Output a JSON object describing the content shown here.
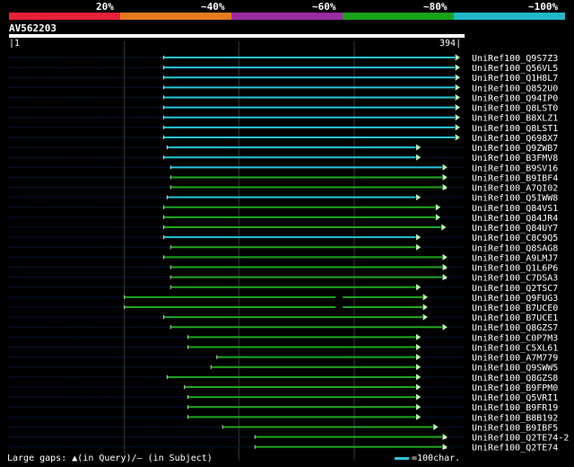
{
  "legend": {
    "segments": [
      {
        "label": "20%",
        "color": "#e8203a"
      },
      {
        "label": "~40%",
        "color": "#e67a1e"
      },
      {
        "label": "~60%",
        "color": "#9a2ba4"
      },
      {
        "label": "~80%",
        "color": "#1aa21a"
      },
      {
        "label": "~100%",
        "color": "#20b8c8"
      }
    ]
  },
  "query": {
    "name": "AV562203",
    "start": "1",
    "end": "394"
  },
  "colors": {
    "high": "#27c6d8",
    "mid": "#1fa81f",
    "arrow": "#b8f5b0",
    "gap": "#3a3a3a",
    "track": "#0a1a4a"
  },
  "hits": [
    {
      "name": "UniRef100_Q9S7Z3",
      "qstart": 135,
      "qend": 392,
      "identity": "high"
    },
    {
      "name": "UniRef100_Q56VL5",
      "qstart": 135,
      "qend": 392,
      "identity": "high"
    },
    {
      "name": "UniRef100_Q1H8L7",
      "qstart": 135,
      "qend": 392,
      "identity": "high"
    },
    {
      "name": "UniRef100_Q852U0",
      "qstart": 135,
      "qend": 392,
      "identity": "high"
    },
    {
      "name": "UniRef100_Q94IP0",
      "qstart": 135,
      "qend": 392,
      "identity": "high"
    },
    {
      "name": "UniRef100_Q8LST0",
      "qstart": 135,
      "qend": 392,
      "identity": "high"
    },
    {
      "name": "UniRef100_B8XLZ1",
      "qstart": 135,
      "qend": 392,
      "identity": "high"
    },
    {
      "name": "UniRef100_Q8LST1",
      "qstart": 135,
      "qend": 392,
      "identity": "high"
    },
    {
      "name": "UniRef100_Q698X7",
      "qstart": 135,
      "qend": 392,
      "identity": "high"
    },
    {
      "name": "UniRef100_Q9ZWB7",
      "qstart": 138,
      "qend": 358,
      "identity": "high"
    },
    {
      "name": "UniRef100_B3FMV8",
      "qstart": 135,
      "qend": 358,
      "identity": "high"
    },
    {
      "name": "UniRef100_B9SV16",
      "qstart": 141,
      "qend": 381,
      "identity": "high"
    },
    {
      "name": "UniRef100_B9IBF4",
      "qstart": 141,
      "qend": 381,
      "identity": "mid"
    },
    {
      "name": "UniRef100_A7QI02",
      "qstart": 141,
      "qend": 381,
      "identity": "mid",
      "gapmark": true
    },
    {
      "name": "UniRef100_Q5IWW8",
      "qstart": 138,
      "qend": 358,
      "identity": "high"
    },
    {
      "name": "UniRef100_Q84VS1",
      "qstart": 135,
      "qend": 375,
      "identity": "mid"
    },
    {
      "name": "UniRef100_Q84JR4",
      "qstart": 135,
      "qend": 375,
      "identity": "mid"
    },
    {
      "name": "UniRef100_Q84UY7",
      "qstart": 135,
      "qend": 380,
      "identity": "mid"
    },
    {
      "name": "UniRef100_C8C9Q5",
      "qstart": 135,
      "qend": 358,
      "identity": "high"
    },
    {
      "name": "UniRef100_Q8SAG8",
      "qstart": 141,
      "qend": 358,
      "identity": "mid"
    },
    {
      "name": "UniRef100_A9LMJ7",
      "qstart": 135,
      "qend": 381,
      "identity": "mid"
    },
    {
      "name": "UniRef100_Q1L6P6",
      "qstart": 141,
      "qend": 381,
      "identity": "mid",
      "gapmark": true
    },
    {
      "name": "UniRef100_C7DSA3",
      "qstart": 141,
      "qend": 381,
      "identity": "mid",
      "gapmark": true
    },
    {
      "name": "UniRef100_Q2TSC7",
      "qstart": 141,
      "qend": 358,
      "identity": "mid"
    },
    {
      "name": "UniRef100_Q9FUG3",
      "qstart": 101,
      "qend": 364,
      "identity": "mid",
      "block": 287
    },
    {
      "name": "UniRef100_B7UCE0",
      "qstart": 101,
      "qend": 364,
      "identity": "mid",
      "block": 287
    },
    {
      "name": "UniRef100_B7UCE1",
      "qstart": 135,
      "qend": 364,
      "identity": "mid"
    },
    {
      "name": "UniRef100_Q8GZS7",
      "qstart": 141,
      "qend": 381,
      "identity": "mid"
    },
    {
      "name": "UniRef100_C0P7M3",
      "qstart": 156,
      "qend": 358,
      "identity": "mid"
    },
    {
      "name": "UniRef100_C5XL61",
      "qstart": 156,
      "qend": 358,
      "identity": "mid"
    },
    {
      "name": "UniRef100_A7M779",
      "qstart": 181,
      "qend": 358,
      "identity": "mid"
    },
    {
      "name": "UniRef100_Q9SWW5",
      "qstart": 176,
      "qend": 358,
      "identity": "mid"
    },
    {
      "name": "UniRef100_Q8GZS8",
      "qstart": 138,
      "qend": 358,
      "identity": "mid"
    },
    {
      "name": "UniRef100_B9FPM0",
      "qstart": 153,
      "qend": 358,
      "identity": "mid"
    },
    {
      "name": "UniRef100_Q5VRI1",
      "qstart": 156,
      "qend": 358,
      "identity": "mid"
    },
    {
      "name": "UniRef100_B9FR19",
      "qstart": 156,
      "qend": 358,
      "identity": "mid"
    },
    {
      "name": "UniRef100_B8B192",
      "qstart": 156,
      "qend": 358,
      "identity": "mid"
    },
    {
      "name": "UniRef100_B9IBF5",
      "qstart": 186,
      "qend": 373,
      "identity": "mid"
    },
    {
      "name": "UniRef100_Q2TE74-2",
      "qstart": 214,
      "qend": 381,
      "identity": "mid",
      "gapmark": true
    },
    {
      "name": "UniRef100_Q2TE74",
      "qstart": 214,
      "qend": 381,
      "identity": "mid",
      "gapmark": true
    }
  ],
  "footer": {
    "gaps_prefix": "Large gaps: ",
    "gap_query_icon": "▲",
    "gaps_query": "(in Query)/",
    "gap_subject_icon": "–",
    "gaps_subject": " (in Subject)",
    "scale_text": "=100char."
  }
}
